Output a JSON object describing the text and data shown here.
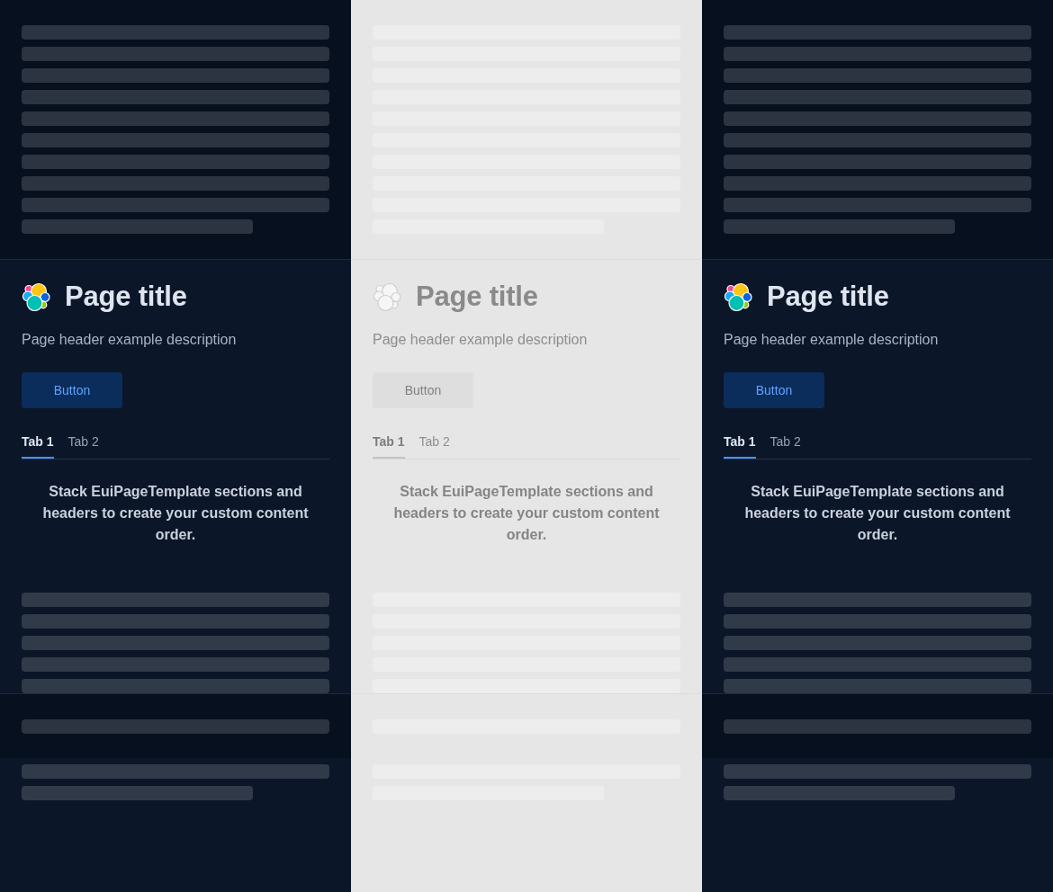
{
  "panels": [
    {
      "faded": false,
      "header": {
        "title": "Page title",
        "description": "Page header example description",
        "button": "Button",
        "tabs": [
          {
            "label": "Tab 1",
            "selected": true
          },
          {
            "label": "Tab 2",
            "selected": false
          }
        ]
      },
      "message": "Stack EuiPageTemplate sections and headers to create your custom content order."
    },
    {
      "faded": true,
      "header": {
        "title": "Page title",
        "description": "Page header example description",
        "button": "Button",
        "tabs": [
          {
            "label": "Tab 1",
            "selected": true
          },
          {
            "label": "Tab 2",
            "selected": false
          }
        ]
      },
      "message": "Stack EuiPageTemplate sections and headers to create your custom content order."
    },
    {
      "faded": false,
      "header": {
        "title": "Page title",
        "description": "Page header example description",
        "button": "Button",
        "tabs": [
          {
            "label": "Tab 1",
            "selected": true
          },
          {
            "label": "Tab 2",
            "selected": false
          }
        ]
      },
      "message": "Stack EuiPageTemplate sections and headers to create your custom content order."
    }
  ]
}
